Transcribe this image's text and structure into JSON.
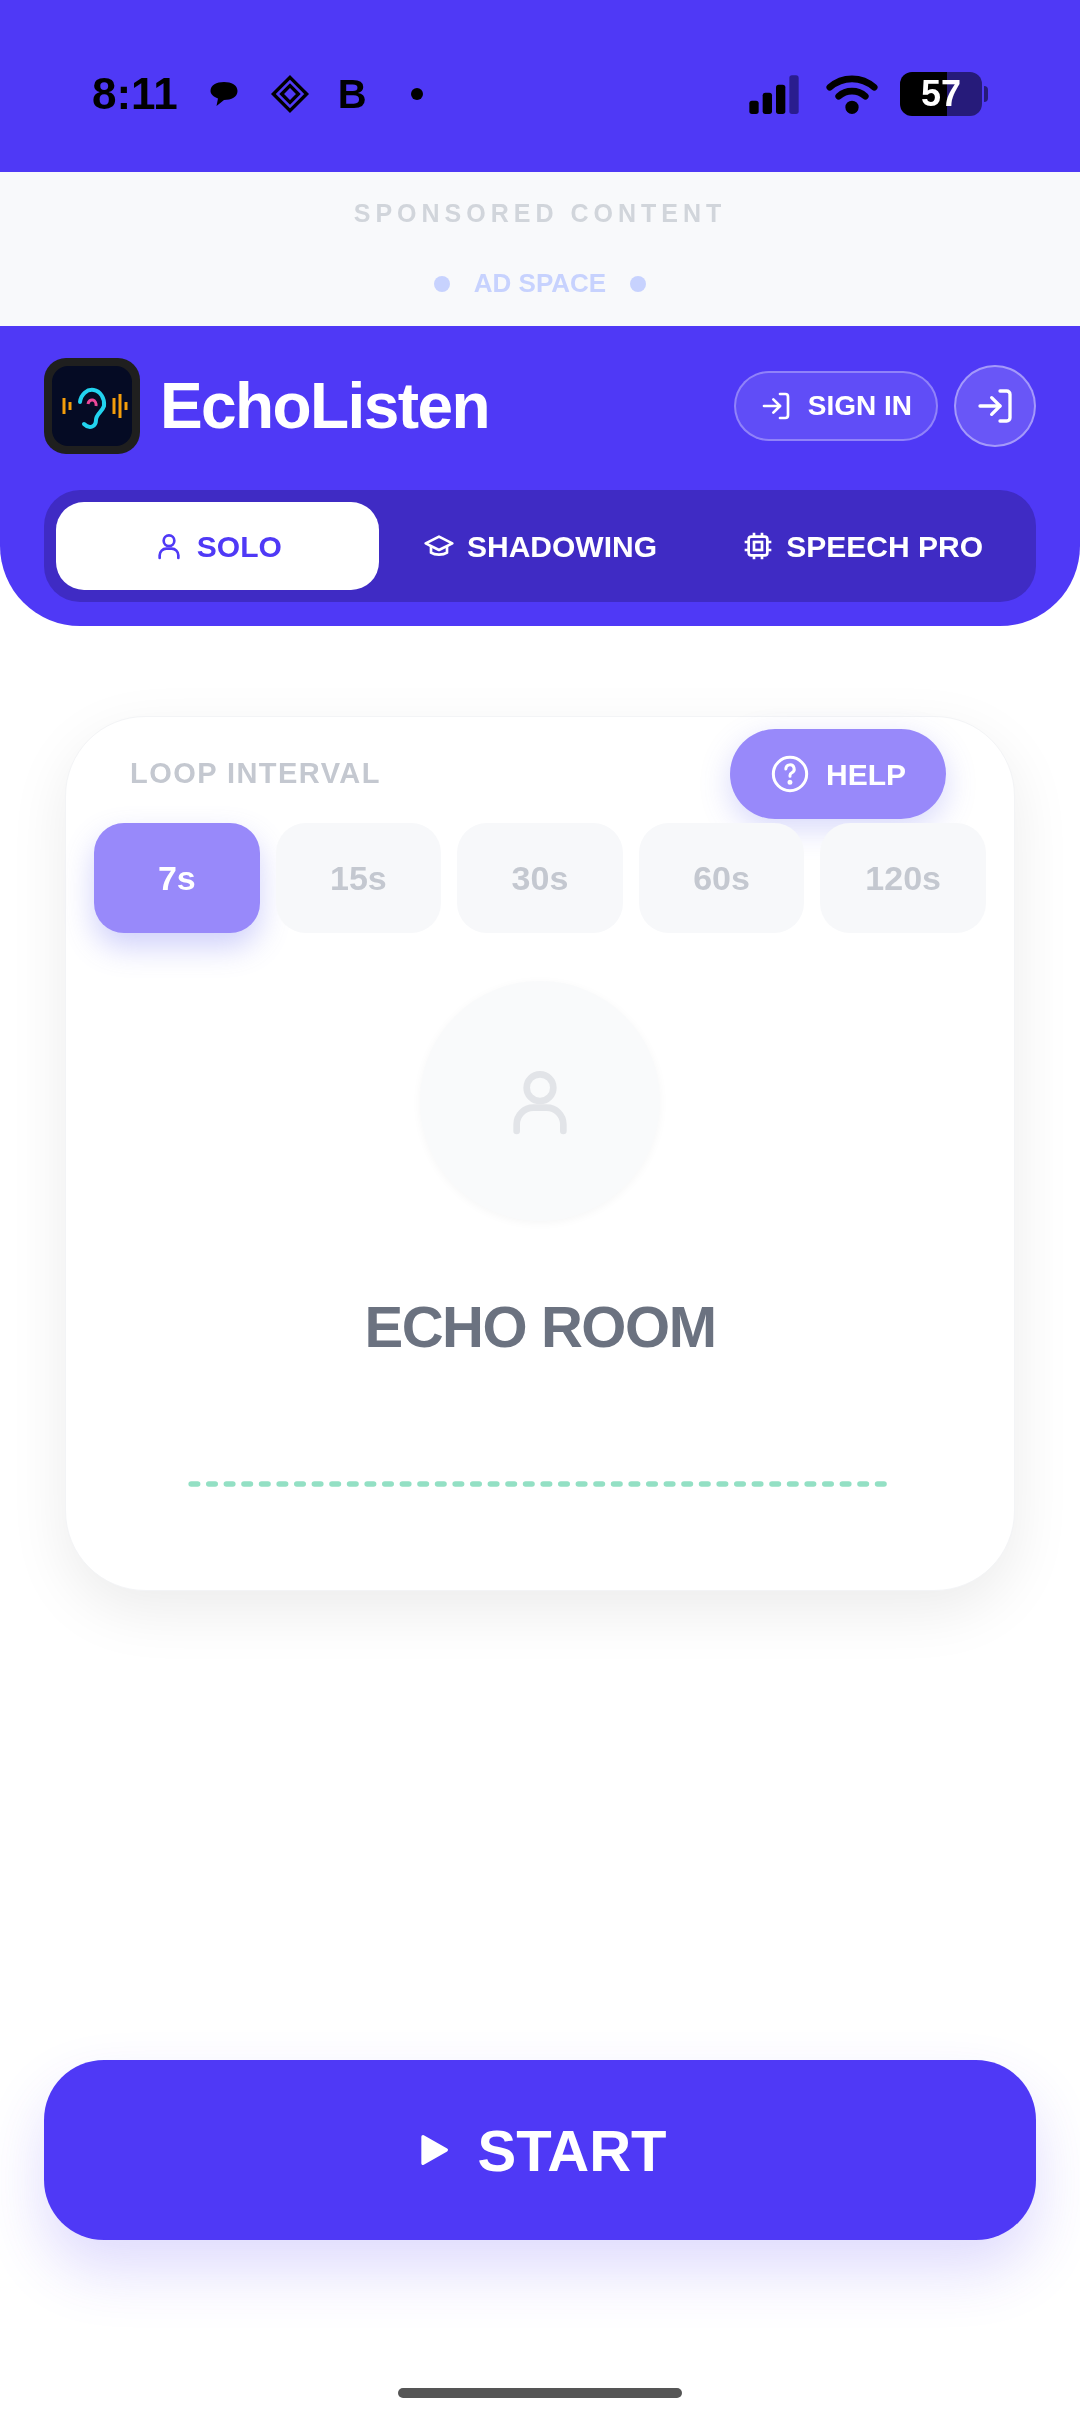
{
  "status_bar": {
    "time": "8:11",
    "notification_letter": "B",
    "battery": "57"
  },
  "ad": {
    "label": "SPONSORED CONTENT",
    "text": "AD SPACE"
  },
  "header": {
    "app_name": "EchoListen",
    "sign_in": "SIGN IN"
  },
  "tabs": [
    {
      "label": "SOLO",
      "kind": "person",
      "selected": true
    },
    {
      "label": "SHADOWING",
      "kind": "cap",
      "selected": false
    },
    {
      "label": "SPEECH PRO",
      "kind": "chip",
      "selected": false
    }
  ],
  "card": {
    "label": "LOOP INTERVAL",
    "help": "HELP",
    "title": "ECHO ROOM",
    "intervals": [
      {
        "label": "7s",
        "selected": true
      },
      {
        "label": "15s",
        "selected": false
      },
      {
        "label": "30s",
        "selected": false
      },
      {
        "label": "60s",
        "selected": false
      },
      {
        "label": "120s",
        "selected": false
      }
    ]
  },
  "start_button": {
    "label": "START"
  }
}
